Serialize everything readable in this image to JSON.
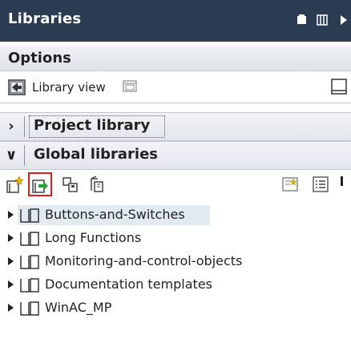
{
  "panel": {
    "title": "Libraries"
  },
  "options": {
    "label": "Options",
    "library_view_label": "Library view"
  },
  "sections": {
    "project_library": "Project library",
    "global_libraries": "Global libraries"
  },
  "toolbar": {
    "buttons": [
      "new-library-icon",
      "open-library-icon",
      "save-library-icon",
      "close-library-icon"
    ],
    "selected": "open-library-icon"
  },
  "global_libraries": {
    "items": [
      {
        "label": "Buttons-and-Switches",
        "selected": true
      },
      {
        "label": "Long Functions",
        "selected": false
      },
      {
        "label": "Monitoring-and-control-objects",
        "selected": false
      },
      {
        "label": "Documentation templates",
        "selected": false
      },
      {
        "label": "WinAC_MP",
        "selected": false
      }
    ]
  },
  "colors": {
    "header_bg": "#2b3b52",
    "selection_outline": "#d62020",
    "selection_bg": "#e3e9f1"
  }
}
